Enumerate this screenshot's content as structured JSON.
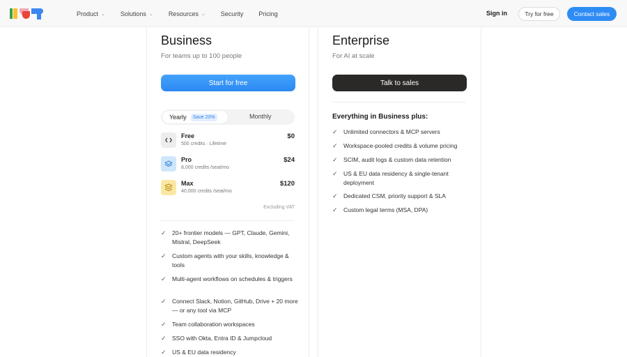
{
  "nav": {
    "items": [
      {
        "label": "Product",
        "has_dropdown": true
      },
      {
        "label": "Solutions",
        "has_dropdown": true
      },
      {
        "label": "Resources",
        "has_dropdown": true
      },
      {
        "label": "Security",
        "has_dropdown": false
      },
      {
        "label": "Pricing",
        "has_dropdown": false
      }
    ],
    "sign_in": "Sign in",
    "try_free": "Try for free",
    "contact_sales": "Contact sales"
  },
  "colors": {
    "brand_blue": "#2f8cf5",
    "dark_button": "#2b2927",
    "logo_green": "#3aa14a",
    "logo_yellow": "#f6c12d",
    "logo_red": "#e8453c",
    "logo_pink": "#f3a7b3",
    "logo_blue": "#3c86f1"
  },
  "business": {
    "title": "Business",
    "subtitle": "For teams up to 100 people",
    "cta": "Start for free",
    "billing": {
      "yearly": "Yearly",
      "save_badge": "Save 20%",
      "monthly": "Monthly",
      "selected": "Yearly"
    },
    "tiers": [
      {
        "name": "Free",
        "meta": "500 credits · Lifetime",
        "price": "$0",
        "icon": "code-icon"
      },
      {
        "name": "Pro",
        "meta": "8,000 credits /seat/mo",
        "price": "$24",
        "icon": "layers-icon"
      },
      {
        "name": "Max",
        "meta": "40,000 credits /seat/mo",
        "price": "$120",
        "icon": "stack-icon"
      }
    ],
    "vat_note": "Excluding VAT",
    "features": [
      "20+ frontier models — GPT, Claude, Gemini, Mistral, DeepSeek",
      "Custom agents with your skills, knowledge & tools",
      "Multi-agent workflows on schedules & triggers",
      "Connect Slack, Notion, GitHub, Drive + 20 more — or any tool via MCP",
      "Team collaboration workspaces",
      "SSO with Okta, Entra ID & Jumpcloud",
      "US & EU data residency"
    ]
  },
  "enterprise": {
    "title": "Enterprise",
    "subtitle": "For AI at scale",
    "cta": "Talk to sales",
    "features_heading": "Everything in Business plus:",
    "features": [
      "Unlimited connectors & MCP servers",
      "Workspace-pooled credits & volume pricing",
      "SCIM, audit logs & custom data retention",
      "US & EU data residency & single-tenant deployment",
      "Dedicated CSM, priority support & SLA",
      "Custom legal terms (MSA, DPA)"
    ]
  }
}
